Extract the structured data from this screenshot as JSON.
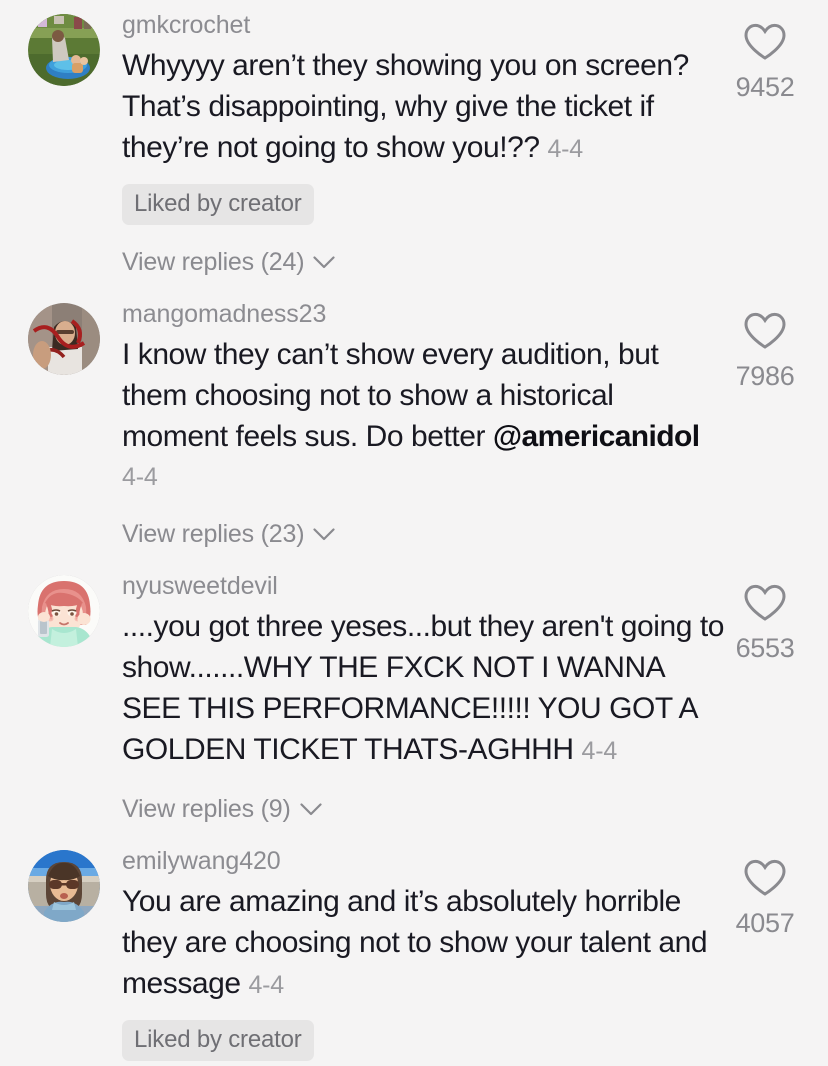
{
  "theme": {
    "background": "#f5f4f4",
    "text_color": "#191922",
    "muted_color": "#8a8a8f",
    "badge_bg": "#e6e5e5"
  },
  "icons": {
    "heart": "heart-outline-icon",
    "chevron": "chevron-down-icon"
  },
  "comments": [
    {
      "username": "gmkcrochet",
      "text": "Whyyyy aren’t they showing you on screen? That’s disappointing, why give the ticket if they’re not going to show you!?? ",
      "mention": "",
      "timestamp": "4-4",
      "timestamp_inline": true,
      "liked_by_creator": "Liked by creator",
      "has_liked_badge": true,
      "view_replies": "View replies (24)",
      "has_view_replies": true,
      "like_count": "9452",
      "avatar": "photo-person-kiddie-pool"
    },
    {
      "username": "mangomadness23",
      "text": "I know they can’t show every audition, but them choosing not to show a historical moment feels sus. Do better ",
      "mention": "@americanidol",
      "timestamp": "4-4",
      "timestamp_inline": false,
      "liked_by_creator": "",
      "has_liked_badge": false,
      "view_replies": "View replies (23)",
      "has_view_replies": true,
      "like_count": "7986",
      "avatar": "photo-person-red-tones"
    },
    {
      "username": "nyusweetdevil",
      "text": "....you got three yeses...but they aren't going to show.......WHY THE FXCK NOT I WANNA SEE THIS PERFORMANCE!!!!! YOU GOT A GOLDEN TICKET THATS-AGHHH ",
      "mention": "",
      "timestamp": "4-4",
      "timestamp_inline": true,
      "liked_by_creator": "",
      "has_liked_badge": false,
      "view_replies": "View replies (9)",
      "has_view_replies": true,
      "like_count": "6553",
      "avatar": "anime-pink-hair-phone"
    },
    {
      "username": "emilywang420",
      "text": "You are amazing and it’s absolutely horrible they are choosing not to show your talent and message ",
      "mention": "",
      "timestamp": "4-4",
      "timestamp_inline": true,
      "liked_by_creator": "Liked by creator",
      "has_liked_badge": true,
      "view_replies": "",
      "has_view_replies": false,
      "like_count": "4057",
      "avatar": "selfie-sunglasses-sky"
    }
  ]
}
